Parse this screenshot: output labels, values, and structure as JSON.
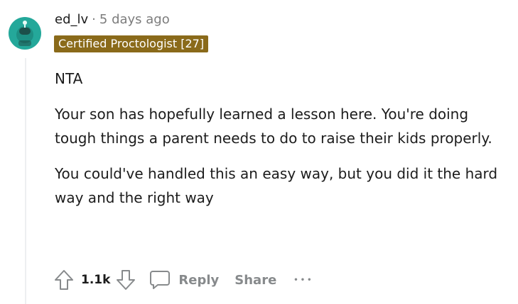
{
  "comment": {
    "username": "ed_lv",
    "separator": "·",
    "timestamp": "5 days ago",
    "flair": "Certified Proctologist [27]",
    "avatar_icon": "snoo-avatar-icon",
    "avatar_color": "#24a89a",
    "flair_color": "#8a6a1a",
    "paragraphs": [
      "NTA",
      "Your son has hopefully learned a lesson here. You're doing tough things a parent needs to do to raise their kids properly.",
      "You could've handled this an easy way, but you did it the hard way and the right way"
    ]
  },
  "actions": {
    "upvote_icon": "upvote-arrow-icon",
    "score": "1.1k",
    "downvote_icon": "downvote-arrow-icon",
    "reply_icon": "speech-bubble-icon",
    "reply_label": "Reply",
    "share_label": "Share",
    "more_label": "•••"
  }
}
